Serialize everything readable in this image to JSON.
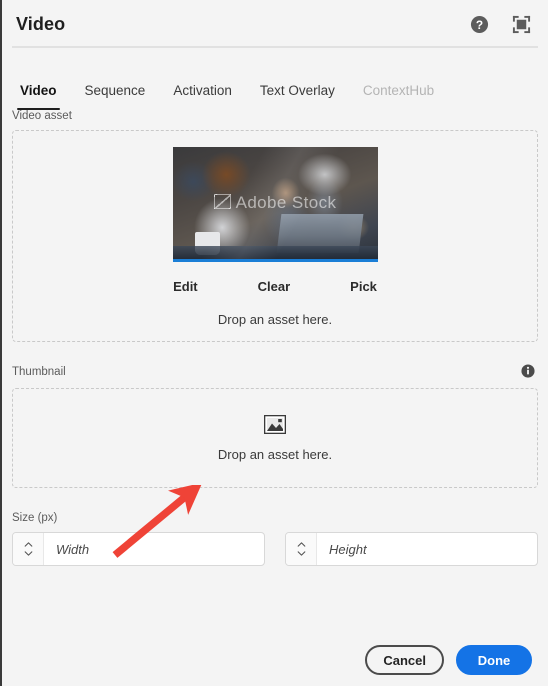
{
  "header": {
    "title": "Video",
    "help_icon": "help-circle-icon",
    "fullscreen_icon": "fullscreen-icon"
  },
  "tabs": [
    {
      "label": "Video",
      "state": "selected"
    },
    {
      "label": "Sequence",
      "state": "default"
    },
    {
      "label": "Activation",
      "state": "default"
    },
    {
      "label": "Text Overlay",
      "state": "default"
    },
    {
      "label": "ContextHub",
      "state": "disabled"
    }
  ],
  "video_asset": {
    "label": "Video asset",
    "preview_watermark": "Adobe Stock",
    "actions": [
      {
        "label": "Edit"
      },
      {
        "label": "Clear"
      },
      {
        "label": "Pick"
      }
    ],
    "drop_hint": "Drop an asset here."
  },
  "thumbnail": {
    "label": "Thumbnail",
    "info_icon": "info-icon",
    "placeholder_icon": "image-icon",
    "drop_hint": "Drop an asset here."
  },
  "size": {
    "label": "Size (px)",
    "width": {
      "value": "",
      "placeholder": "Width"
    },
    "height": {
      "value": "",
      "placeholder": "Height"
    }
  },
  "footer": {
    "cancel_label": "Cancel",
    "done_label": "Done"
  },
  "colors": {
    "accent": "#1473e6",
    "background": "#f4f4f4",
    "annotation_arrow": "#ef4337",
    "tab_underline": "#1f1f1f",
    "disabled_text": "#b4b4b4"
  }
}
